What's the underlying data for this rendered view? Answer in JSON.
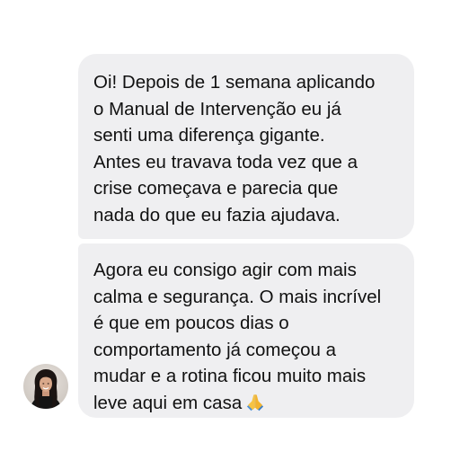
{
  "conversation": {
    "messages": [
      {
        "lines": [
          "Oi! Depois de 1 semana aplicando",
          "o Manual de Intervenção eu já",
          "senti uma diferença gigante.",
          "Antes eu travava toda vez que a",
          "crise começava e parecia que",
          "nada do que eu fazia ajudava."
        ]
      },
      {
        "lines": [
          "Agora eu consigo agir com mais",
          "calma e segurança. O mais incrível",
          "é que em poucos dias o",
          "comportamento já começou a",
          "mudar e a rotina ficou muito mais",
          "leve aqui em casa"
        ],
        "trailing_emoji": "folded-hands-icon"
      }
    ],
    "sender_avatar": "avatar-photo-woman"
  },
  "colors": {
    "bubble_background": "#efeff1",
    "text": "#111111",
    "page_background": "#ffffff"
  }
}
